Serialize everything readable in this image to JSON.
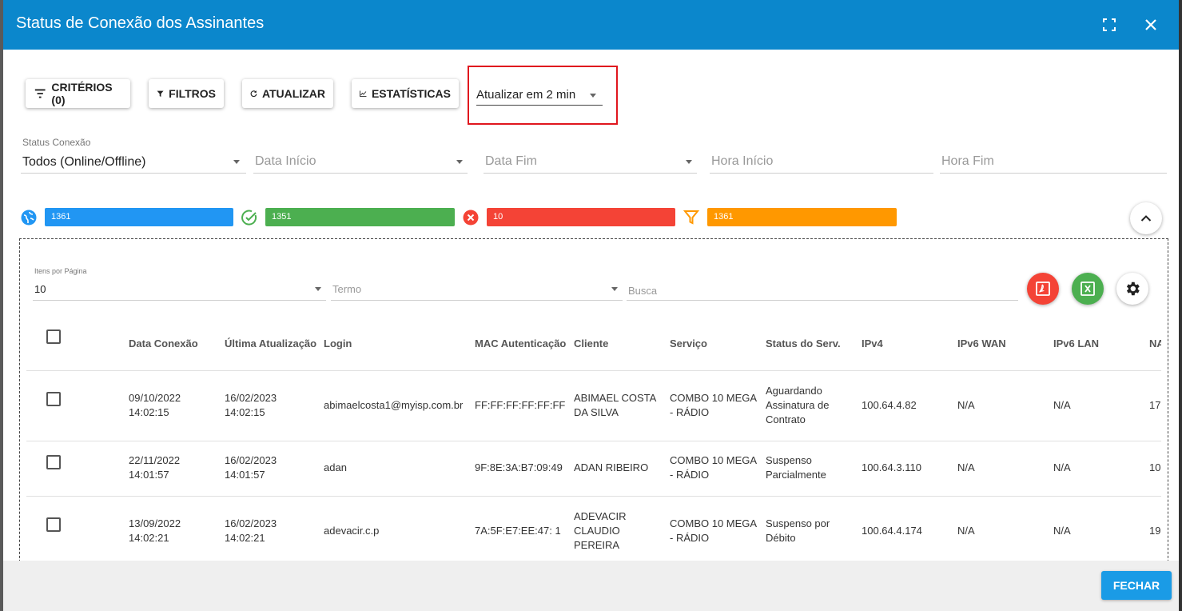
{
  "dialog": {
    "title": "Status de Conexão dos Assinantes"
  },
  "toolbar": {
    "criterios": "CRITÉRIOS (0)",
    "filtros": "FILTROS",
    "atualizar": "ATUALIZAR",
    "estatisticas": "ESTATÍSTICAS",
    "refresh_interval": "Atualizar em 2 min"
  },
  "filters": {
    "status_label": "Status Conexão",
    "status_value": "Todos (Online/Offline)",
    "data_inicio": "Data Início",
    "data_fim": "Data Fim",
    "hora_inicio": "Hora Início",
    "hora_fim": "Hora Fim"
  },
  "stats": {
    "total": "1361",
    "online": "1351",
    "offline": "10",
    "filtered": "1361",
    "colors": {
      "total": "#2196f3",
      "online": "#4caf50",
      "offline": "#f44336",
      "filtered": "#ff9800"
    }
  },
  "table_controls": {
    "items_label": "Itens por Página",
    "items_value": "10",
    "termo_placeholder": "Termo",
    "busca_placeholder": "Busca"
  },
  "table": {
    "headers": [
      "Data Conexão",
      "Última Atualização",
      "Login",
      "MAC Autenticação",
      "Cliente",
      "Serviço",
      "Status do Serv.",
      "IPv4",
      "IPv6 WAN",
      "IPv6 LAN",
      "NA"
    ],
    "rows": [
      {
        "data_conexao": [
          "09/10/2022",
          "14:02:15"
        ],
        "ultima": [
          "16/02/2023",
          "14:02:15"
        ],
        "login": "abimaelcosta1@myisp.com.br",
        "mac": "FF:FF:FF:FF:FF:FF",
        "cliente": [
          "ABIMAEL COSTA",
          "DA SILVA"
        ],
        "servico": [
          "COMBO 10 MEGA",
          "- RÁDIO"
        ],
        "status": [
          "Aguardando",
          "Assinatura de",
          "Contrato"
        ],
        "ipv4": "100.64.4.82",
        "ipv6wan": "N/A",
        "ipv6lan": "N/A",
        "na": "17"
      },
      {
        "data_conexao": [
          "22/11/2022",
          "14:01:57"
        ],
        "ultima": [
          "16/02/2023",
          "14:01:57"
        ],
        "login": "adan",
        "mac": "9F:8E:3A:B7:09:49",
        "cliente": [
          "ADAN RIBEIRO"
        ],
        "servico": [
          "COMBO 10 MEGA",
          "- RÁDIO"
        ],
        "status": [
          "Suspenso",
          "Parcialmente"
        ],
        "ipv4": "100.64.3.110",
        "ipv6wan": "N/A",
        "ipv6lan": "N/A",
        "na": "10"
      },
      {
        "data_conexao": [
          "13/09/2022",
          "14:02:21"
        ],
        "ultima": [
          "16/02/2023",
          "14:02:21"
        ],
        "login": "adevacir.c.p",
        "mac": "7A:5F:E7:EE:47: 1",
        "cliente": [
          "ADEVACIR",
          "CLAUDIO",
          "PEREIRA"
        ],
        "servico": [
          "COMBO 10 MEGA",
          "- RÁDIO"
        ],
        "status": [
          "Suspenso por",
          "Débito"
        ],
        "ipv4": "100.64.4.174",
        "ipv6wan": "N/A",
        "ipv6lan": "N/A",
        "na": "19"
      }
    ]
  },
  "footer": {
    "fechar": "FECHAR"
  }
}
